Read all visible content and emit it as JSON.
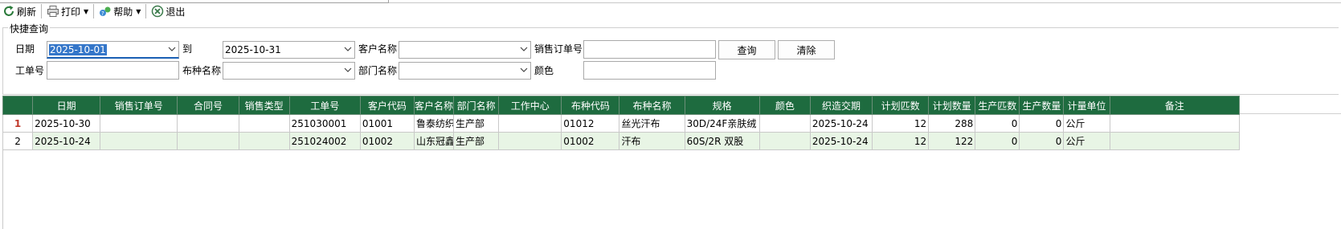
{
  "toolbar": {
    "refresh_label": "刷新",
    "print_label": "打印",
    "help_label": "帮助",
    "exit_label": "退出"
  },
  "query": {
    "group_title": "快捷查询",
    "date_label": "日期",
    "date_from": "2025-10-01",
    "to_label": "到",
    "date_to": "2025-10-31",
    "customer_name_label": "客户名称",
    "customer_name_value": "",
    "sales_order_label": "销售订单号",
    "sales_order_value": "",
    "query_button": "查询",
    "clear_button": "清除",
    "work_order_label": "工单号",
    "work_order_value": "",
    "fabric_name_label": "布种名称",
    "fabric_name_value": "",
    "department_label": "部门名称",
    "department_value": "",
    "color_label": "颜色",
    "color_value": ""
  },
  "grid": {
    "columns": [
      "",
      "日期",
      "销售订单号",
      "合同号",
      "销售类型",
      "工单号",
      "客户代码",
      "客户名称",
      "部门名称",
      "工作中心",
      "布种代码",
      "布种名称",
      "规格",
      "颜色",
      "织造交期",
      "计划匹数",
      "计划数量",
      "生产匹数",
      "生产数量",
      "计量单位",
      "备注"
    ],
    "rows": [
      [
        "1",
        "2025-10-30",
        "",
        "",
        "",
        "251030001",
        "01001",
        "鲁泰纺织",
        "生产部",
        "",
        "01012",
        "丝光汗布",
        "30D/24F亲肤绒",
        "",
        "2025-10-24",
        "12",
        "288",
        "0",
        "0",
        "公斤",
        ""
      ],
      [
        "2",
        "2025-10-24",
        "",
        "",
        "",
        "251024002",
        "01002",
        "山东冠鑫",
        "生产部",
        "",
        "01002",
        "汗布",
        "60S/2R 双股",
        "",
        "2025-10-24",
        "12",
        "122",
        "0",
        "0",
        "公斤",
        ""
      ]
    ]
  },
  "colors": {
    "header_bg": "#1e6b3f",
    "alt_row_bg": "#e8f5e5",
    "selection_bg": "#3476c9"
  },
  "icons": {
    "refresh": "refresh-icon",
    "print": "printer-icon",
    "help": "help-icon",
    "exit": "exit-icon"
  }
}
